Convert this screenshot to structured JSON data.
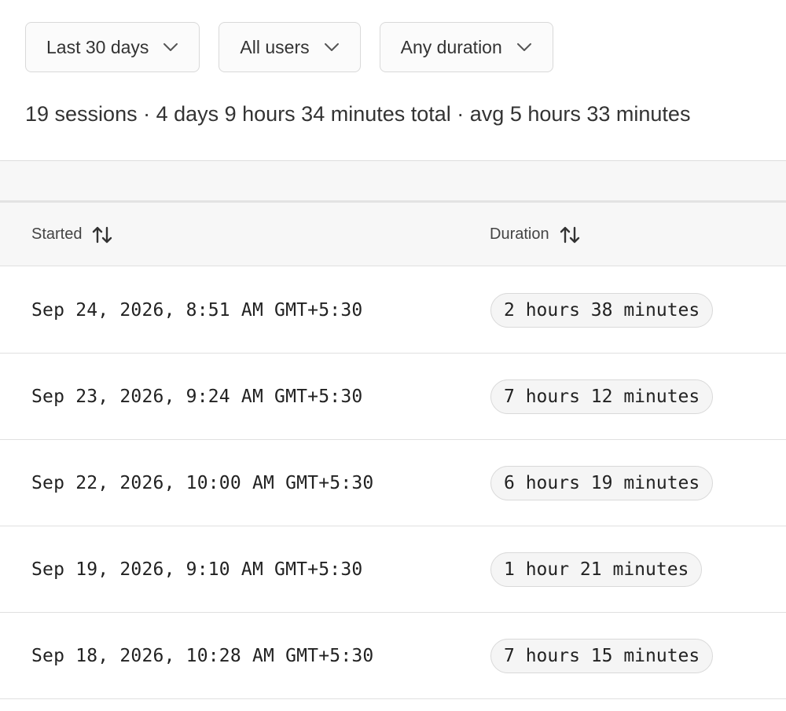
{
  "filters": {
    "range": {
      "label": "Last 30 days",
      "icon": "chevron-down-icon"
    },
    "users": {
      "label": "All users",
      "icon": "chevron-down-icon"
    },
    "duration": {
      "label": "Any duration",
      "icon": "chevron-down-icon"
    }
  },
  "summary": "19 sessions · 4 days 9 hours 34 minutes total · avg 5 hours 33 minutes",
  "table": {
    "columns": [
      {
        "label": "Started",
        "icon": "sort-icon"
      },
      {
        "label": "Duration",
        "icon": "sort-icon"
      }
    ],
    "rows": [
      {
        "started": "Sep 24, 2026, 8:51 AM GMT+5:30",
        "duration": "2 hours 38 minutes"
      },
      {
        "started": "Sep 23, 2026, 9:24 AM GMT+5:30",
        "duration": "7 hours 12 minutes"
      },
      {
        "started": "Sep 22, 2026, 10:00 AM GMT+5:30",
        "duration": "6 hours 19 minutes"
      },
      {
        "started": "Sep 19, 2026, 9:10 AM GMT+5:30",
        "duration": "1 hour 21 minutes"
      },
      {
        "started": "Sep 18, 2026, 10:28 AM GMT+5:30",
        "duration": "7 hours 15 minutes"
      }
    ]
  },
  "colors": {
    "text": "#333333",
    "border": "#d9d9d9",
    "header_bg": "#f7f7f7",
    "pill_bg": "#f5f5f5"
  }
}
